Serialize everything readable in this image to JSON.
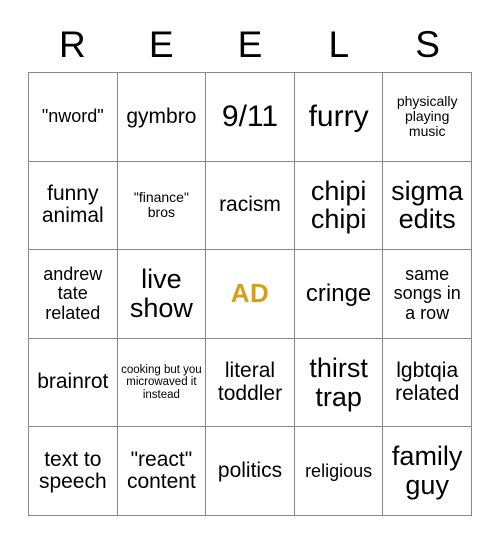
{
  "card": {
    "title_letters": [
      "R",
      "E",
      "E",
      "L",
      "S"
    ],
    "free_space_color": "#d4a017",
    "grid_line_color": "#888888",
    "rows": [
      [
        {
          "text": "\"nword\"",
          "size": "sm"
        },
        {
          "text": "gymbro",
          "size": "md"
        },
        {
          "text": "9/11",
          "size": "xxl"
        },
        {
          "text": "furry",
          "size": "xxl"
        },
        {
          "text": "physically playing music",
          "size": "xs"
        }
      ],
      [
        {
          "text": "funny animal",
          "size": "md"
        },
        {
          "text": "\"finance\" bros",
          "size": "xs"
        },
        {
          "text": "racism",
          "size": "md"
        },
        {
          "text": "chipi chipi",
          "size": "xl"
        },
        {
          "text": "sigma edits",
          "size": "xl"
        }
      ],
      [
        {
          "text": "andrew tate related",
          "size": "sm"
        },
        {
          "text": "live show",
          "size": "xl"
        },
        {
          "text": "AD",
          "size": "free",
          "free": true
        },
        {
          "text": "cringe",
          "size": "lg"
        },
        {
          "text": "same songs in a row",
          "size": "sm"
        }
      ],
      [
        {
          "text": "brainrot",
          "size": "md"
        },
        {
          "text": "cooking but you microwaved it instead",
          "size": "xxs"
        },
        {
          "text": "literal toddler",
          "size": "md"
        },
        {
          "text": "thirst trap",
          "size": "xl"
        },
        {
          "text": "lgbtqia related",
          "size": "md"
        }
      ],
      [
        {
          "text": "text to speech",
          "size": "md"
        },
        {
          "text": "\"react\" content",
          "size": "md"
        },
        {
          "text": "politics",
          "size": "md"
        },
        {
          "text": "religious",
          "size": "sm"
        },
        {
          "text": "family guy",
          "size": "xl"
        }
      ]
    ]
  }
}
